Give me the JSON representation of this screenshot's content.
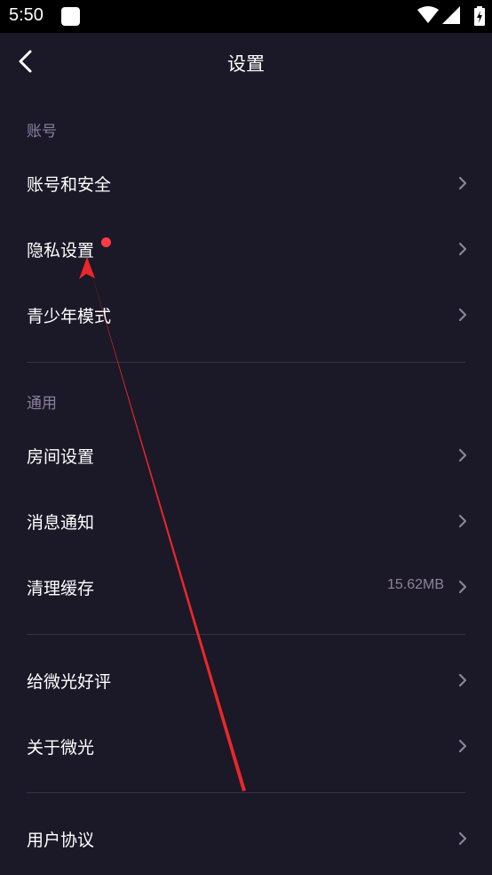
{
  "status_bar": {
    "time": "5:50",
    "icons": [
      "app-notification-icon",
      "wifi-icon",
      "signal-icon",
      "battery-charging-icon"
    ]
  },
  "header": {
    "title": "设置",
    "back_icon": "chevron-left-icon"
  },
  "sections": {
    "account": {
      "title": "账号",
      "items": [
        {
          "label": "账号和安全"
        },
        {
          "label": "隐私设置",
          "badge": true
        },
        {
          "label": "青少年模式"
        }
      ]
    },
    "general": {
      "title": "通用",
      "items": [
        {
          "label": "房间设置"
        },
        {
          "label": "消息通知"
        },
        {
          "label": "清理缓存",
          "value": "15.62MB"
        }
      ]
    },
    "about": {
      "items": [
        {
          "label": "给微光好评"
        },
        {
          "label": "关于微光"
        }
      ]
    },
    "legal": {
      "items": [
        {
          "label": "用户协议"
        }
      ]
    }
  },
  "colors": {
    "background": "#1b1827",
    "section_header": "#8a7fa0",
    "divider": "#37324a",
    "badge": "#ff3b48",
    "annotation_arrow": "#e8282b"
  }
}
